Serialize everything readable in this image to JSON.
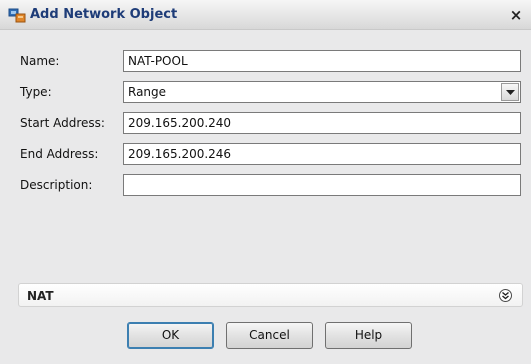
{
  "window": {
    "title": "Add Network Object",
    "app_icon": "network-object-icon",
    "close_glyph": "×"
  },
  "form": {
    "name_label": "Name:",
    "name_value": "NAT-POOL",
    "type_label": "Type:",
    "type_value": "Range",
    "start_label": "Start Address:",
    "start_value": "209.165.200.240",
    "end_label": "End Address:",
    "end_value": "209.165.200.246",
    "description_label": "Description:",
    "description_value": ""
  },
  "nat_section": {
    "label": "NAT",
    "expand_icon": "double-chevron-down-icon"
  },
  "buttons": {
    "ok": "OK",
    "cancel": "Cancel",
    "help": "Help"
  },
  "colors": {
    "title_text": "#1e3c78",
    "background": "#e9e9ea"
  }
}
